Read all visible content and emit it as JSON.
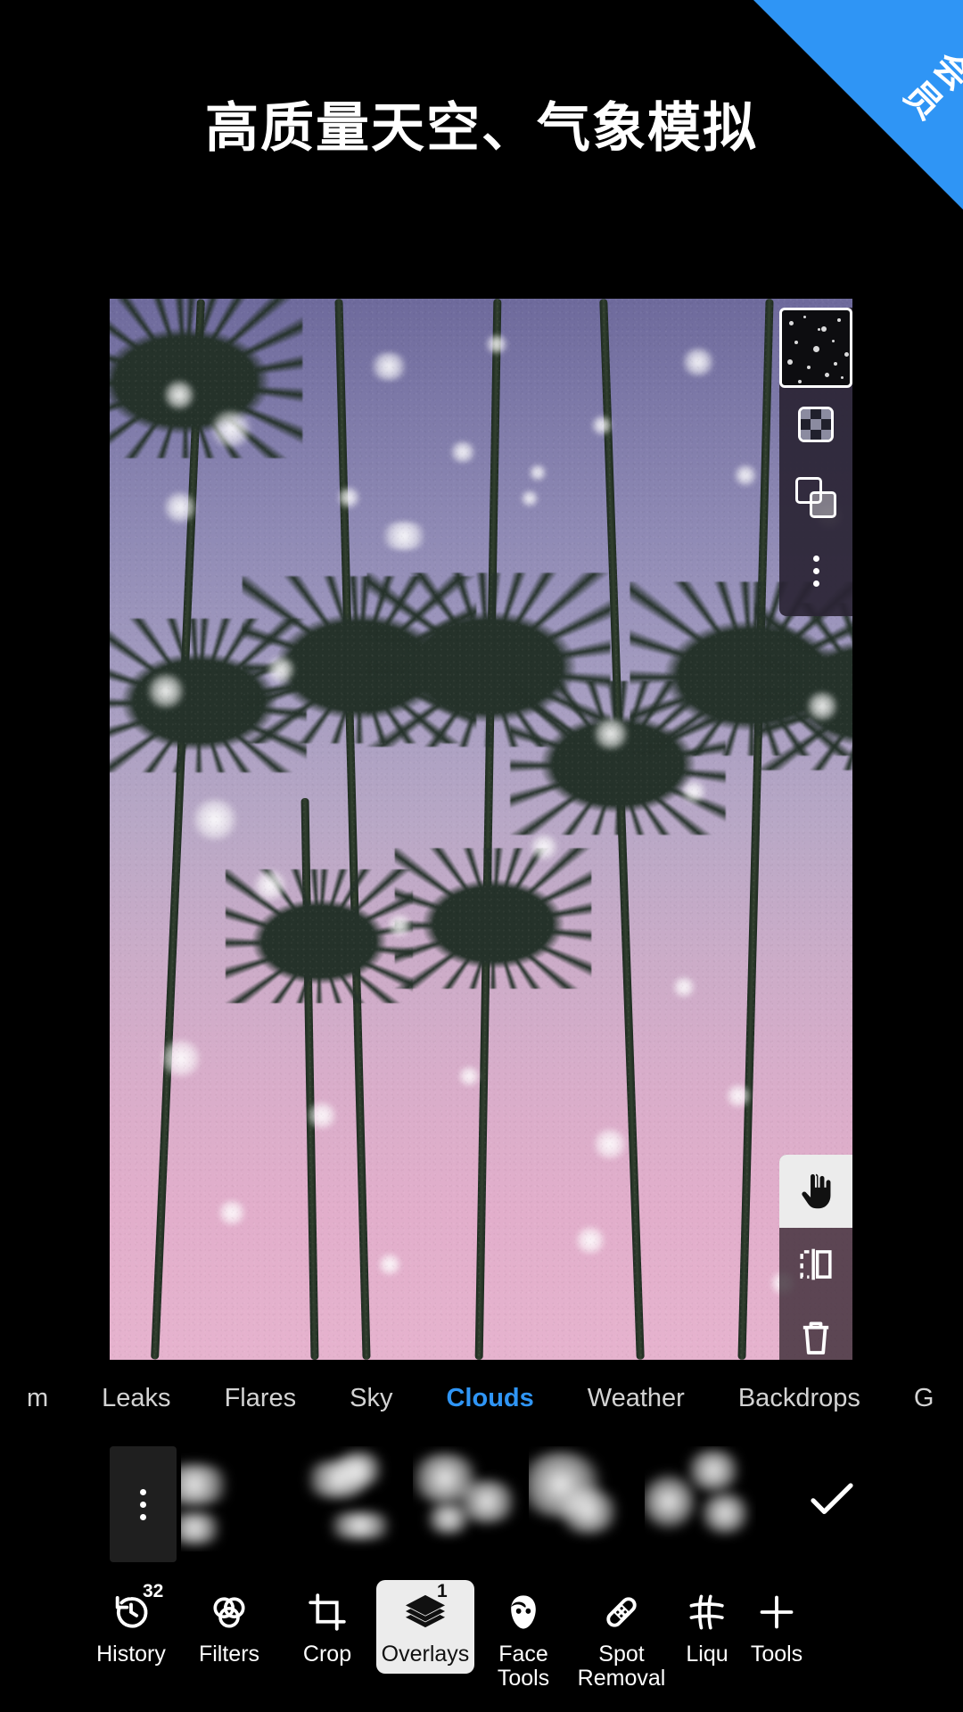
{
  "promo": {
    "ribbon_label": "会员",
    "ribbon_color": "#2f95f5",
    "headline": "高质量天空、气象模拟"
  },
  "canvas": {
    "description": "palm-tree-sky-photo",
    "sky_top_color": "#6e6a9c",
    "sky_bottom_color": "#e6b3ce"
  },
  "layer_panel": {
    "thumbnail_name": "snow-overlay-layer-thumbnail",
    "buttons": [
      {
        "name": "opacity-checkerboard-button",
        "icon": "checkerboard-icon"
      },
      {
        "name": "blend-mode-button",
        "icon": "overlapping-squares-icon"
      },
      {
        "name": "layer-more-button",
        "icon": "three-dots-vertical-icon"
      }
    ]
  },
  "tool_panel": {
    "buttons": [
      {
        "name": "hand-tool",
        "icon": "hand-icon",
        "selected": true
      },
      {
        "name": "flip-tool",
        "icon": "mirror-flip-icon",
        "selected": false
      },
      {
        "name": "delete-tool",
        "icon": "trash-icon",
        "selected": false
      },
      {
        "name": "eraser-tool",
        "icon": "eraser-icon",
        "selected": false
      }
    ]
  },
  "tabs": {
    "active_color": "#2f95f5",
    "items": [
      {
        "label": "m",
        "active": false
      },
      {
        "label": "Leaks",
        "active": false
      },
      {
        "label": "Flares",
        "active": false
      },
      {
        "label": "Sky",
        "active": false
      },
      {
        "label": "Clouds",
        "active": true
      },
      {
        "label": "Weather",
        "active": false
      },
      {
        "label": "Backdrops",
        "active": false
      },
      {
        "label": "G",
        "active": false
      }
    ]
  },
  "strip": {
    "menu_icon": "three-dots-vertical-icon",
    "confirm_icon": "checkmark-icon",
    "thumbnails": [
      {
        "name": "cloud-overlay-thumbnail-1"
      },
      {
        "name": "cloud-overlay-thumbnail-2"
      },
      {
        "name": "cloud-overlay-thumbnail-3"
      },
      {
        "name": "cloud-overlay-thumbnail-4"
      },
      {
        "name": "cloud-overlay-thumbnail-5"
      }
    ]
  },
  "bottom_nav": {
    "items": [
      {
        "label": "History",
        "badge": "32",
        "icon": "history-undo-icon",
        "selected": false
      },
      {
        "label": "Filters",
        "badge": "",
        "icon": "filters-circles-icon",
        "selected": false
      },
      {
        "label": "Crop",
        "badge": "",
        "icon": "crop-icon",
        "selected": false
      },
      {
        "label": "Overlays",
        "badge": "1",
        "icon": "layers-icon",
        "selected": true
      },
      {
        "label": "Face Tools",
        "badge": "",
        "icon": "face-icon",
        "selected": false
      },
      {
        "label": "Spot Removal",
        "badge": "",
        "icon": "bandage-icon",
        "selected": false
      },
      {
        "label": "Liqu",
        "badge": "",
        "icon": "liquify-grid-icon",
        "selected": false
      },
      {
        "label": "Tools",
        "badge": "",
        "icon": "plus-icon",
        "selected": false
      }
    ]
  }
}
